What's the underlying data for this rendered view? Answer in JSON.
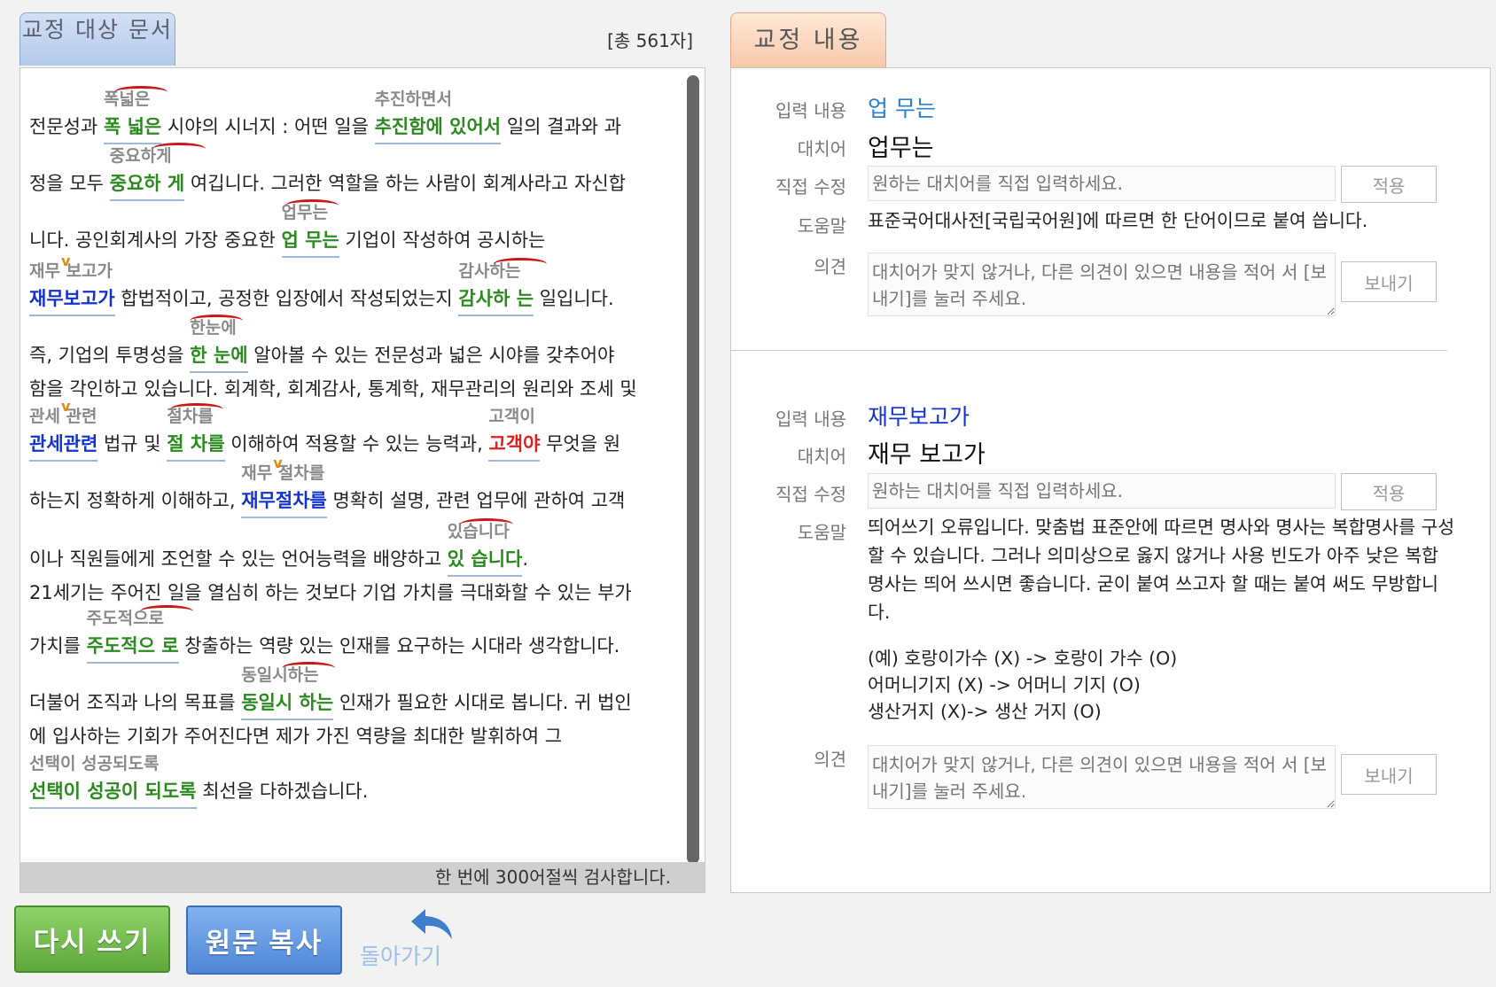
{
  "left_panel": {
    "tab_label": "교정 대상 문서",
    "char_count": "[총 561자]",
    "footer_note": "한 번에 300어절씩 검사합니다.",
    "lines": {
      "l1": {
        "pre": "전문성과 ",
        "w1_sug": "폭넓은",
        "w1": "폭 넓은",
        "mid": " 시야의 시너지 : 어떤 일을 ",
        "w2_sug": "추진하면서",
        "w2": "추진함에 있어서",
        "post": " 일의 결과와 과"
      },
      "l2": {
        "pre": "정을 모두 ",
        "w1_sug": "중요하게",
        "w1": "중요하 게",
        "post": " 여깁니다. 그러한 역할을 하는 사람이 회계사라고 자신합"
      },
      "l3": {
        "pre": "니다. 공인회계사의 가장 중요한 ",
        "w1_sug": "업무는",
        "w1": "업 무는",
        "post": " 기업이 작성하여 공시하는"
      },
      "l4": {
        "w1_sug": "재무 보고가",
        "w1": "재무보고가",
        "mid": " 합법적이고, 공정한 입장에서 작성되었는지 ",
        "w2_sug": "감사하는",
        "w2": "감사하 는",
        "post": " 일입니다."
      },
      "l5": {
        "pre": "즉, 기업의 투명성을 ",
        "w1_sug": "한눈에",
        "w1": "한 눈에",
        "post": " 알아볼 수 있는 전문성과 넓은 시야를 갖추어야"
      },
      "l6": {
        "text": "함을 각인하고 있습니다. 회계학, 회계감사, 통계학, 재무관리의 원리와 조세 및"
      },
      "l7": {
        "w1_sug": "관세 관련",
        "w1": "관세관련",
        "mid": " 법규 및 ",
        "w2_sug": "절차를",
        "w2": "절 차를",
        "mid2": " 이해하여 적용할 수 있는 능력과, ",
        "w3_sug": "고객이",
        "w3": "고객야",
        "post": " 무엇을 원"
      },
      "l8": {
        "pre": "하는지 정확하게 이해하고, ",
        "w1_sug": "재무 절차를",
        "w1": "재무절차를",
        "post": " 명확히 설명, 관련 업무에 관하여 고객"
      },
      "l9": {
        "pre": "이나 직원들에게 조언할 수 있는 언어능력을 배양하고 ",
        "w1_sug": "있습니다",
        "w1": "있 습니다",
        "post": "."
      },
      "l10": {
        "text": "21세기는 주어진 일을 열심히 하는 것보다 기업 가치를 극대화할 수 있는 부가"
      },
      "l11": {
        "pre": "가치를 ",
        "w1_sug": "주도적으로",
        "w1": "주도적으 로",
        "post": " 창출하는 역량 있는 인재를 요구하는 시대라 생각합니다."
      },
      "l12": {
        "pre": "더불어 조직과 나의 목표를 ",
        "w1_sug": "동일시하는",
        "w1": "동일시 하는",
        "post": " 인재가 필요한 시대로 봅니다. 귀 법인"
      },
      "l13": {
        "text": "에 입사하는 기회가 주어진다면 제가 가진 역량을 최대한 발휘하여 그"
      },
      "l14": {
        "w1_sug": "선택이 성공되도록",
        "w1": "선택이 성공이 되도록",
        "post": " 최선을 다하겠습니다."
      }
    }
  },
  "buttons": {
    "rewrite": "다시 쓰기",
    "copy_original": "원문 복사",
    "go_back": "돌아가기"
  },
  "right_panel": {
    "tab_label": "교정 내용",
    "labels": {
      "input": "입력 내용",
      "alternative": "대치어",
      "direct_edit": "직접 수정",
      "help": "도움말",
      "opinion": "의견"
    },
    "direct_edit_placeholder": "원하는 대치어를 직접 입력하세요.",
    "opinion_placeholder": "대치어가 맞지 않거나, 다른 의견이 있으면 내용을 적어 서 [보내기]를 눌러 주세요.",
    "apply_label": "적용",
    "send_label": "보내기",
    "entries": [
      {
        "input": "업 무는",
        "input_color": "#2a7fd4",
        "alternative": "업무는",
        "help": "표준국어대사전[국립국어원]에 따르면 한 단어이므로 붙여 씁니다."
      },
      {
        "input": "재무보고가",
        "input_color": "#1432d0",
        "alternative": "재무 보고가",
        "help": "띄어쓰기 오류입니다. 맞춤법 표준안에 따르면 명사와 명사는 복합명사를 구성할 수 있습니다. 그러나 의미상으로 옳지 않거나 사용 빈도가 아주 낮은 복합 명사는 띄어 쓰시면 좋습니다. 굳이 붙여 쓰고자 할 때는 붙여 써도 무방합니다.",
        "examples": [
          "(예) 호랑이가수 (X) -> 호랑이 가수 (O)",
          "어머니기지 (X) -> 어머니 기지 (O)",
          "생산거지 (X)-> 생산 거지 (O)"
        ]
      }
    ]
  }
}
